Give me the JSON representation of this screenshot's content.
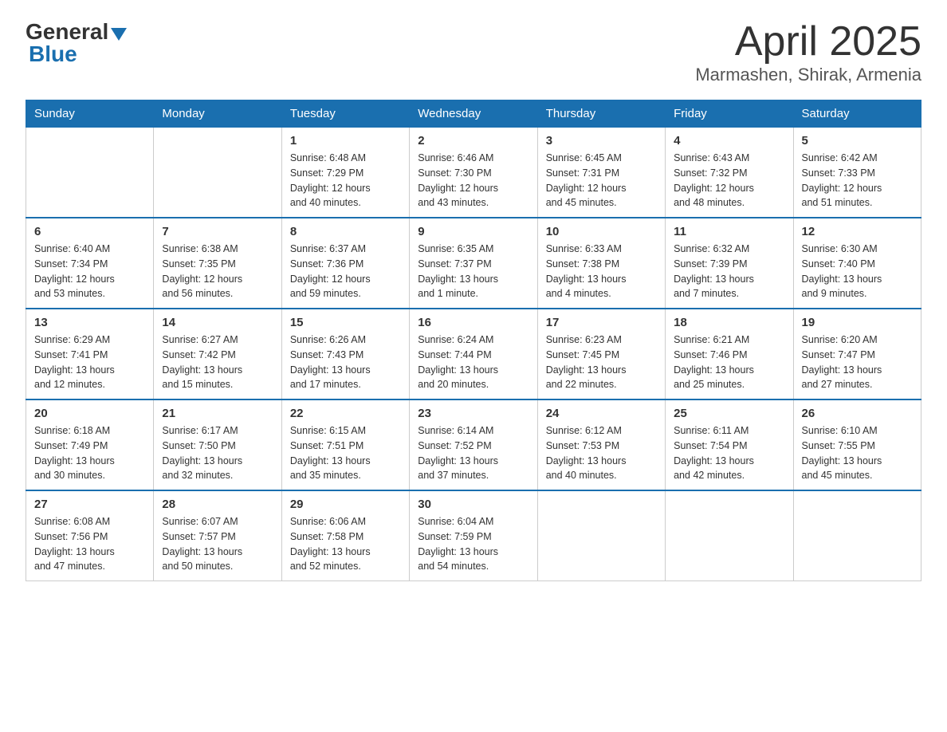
{
  "header": {
    "logo_general": "General",
    "logo_blue": "Blue",
    "title": "April 2025",
    "subtitle": "Marmashen, Shirak, Armenia"
  },
  "days_of_week": [
    "Sunday",
    "Monday",
    "Tuesday",
    "Wednesday",
    "Thursday",
    "Friday",
    "Saturday"
  ],
  "weeks": [
    [
      {
        "day": "",
        "info": ""
      },
      {
        "day": "",
        "info": ""
      },
      {
        "day": "1",
        "info": "Sunrise: 6:48 AM\nSunset: 7:29 PM\nDaylight: 12 hours\nand 40 minutes."
      },
      {
        "day": "2",
        "info": "Sunrise: 6:46 AM\nSunset: 7:30 PM\nDaylight: 12 hours\nand 43 minutes."
      },
      {
        "day": "3",
        "info": "Sunrise: 6:45 AM\nSunset: 7:31 PM\nDaylight: 12 hours\nand 45 minutes."
      },
      {
        "day": "4",
        "info": "Sunrise: 6:43 AM\nSunset: 7:32 PM\nDaylight: 12 hours\nand 48 minutes."
      },
      {
        "day": "5",
        "info": "Sunrise: 6:42 AM\nSunset: 7:33 PM\nDaylight: 12 hours\nand 51 minutes."
      }
    ],
    [
      {
        "day": "6",
        "info": "Sunrise: 6:40 AM\nSunset: 7:34 PM\nDaylight: 12 hours\nand 53 minutes."
      },
      {
        "day": "7",
        "info": "Sunrise: 6:38 AM\nSunset: 7:35 PM\nDaylight: 12 hours\nand 56 minutes."
      },
      {
        "day": "8",
        "info": "Sunrise: 6:37 AM\nSunset: 7:36 PM\nDaylight: 12 hours\nand 59 minutes."
      },
      {
        "day": "9",
        "info": "Sunrise: 6:35 AM\nSunset: 7:37 PM\nDaylight: 13 hours\nand 1 minute."
      },
      {
        "day": "10",
        "info": "Sunrise: 6:33 AM\nSunset: 7:38 PM\nDaylight: 13 hours\nand 4 minutes."
      },
      {
        "day": "11",
        "info": "Sunrise: 6:32 AM\nSunset: 7:39 PM\nDaylight: 13 hours\nand 7 minutes."
      },
      {
        "day": "12",
        "info": "Sunrise: 6:30 AM\nSunset: 7:40 PM\nDaylight: 13 hours\nand 9 minutes."
      }
    ],
    [
      {
        "day": "13",
        "info": "Sunrise: 6:29 AM\nSunset: 7:41 PM\nDaylight: 13 hours\nand 12 minutes."
      },
      {
        "day": "14",
        "info": "Sunrise: 6:27 AM\nSunset: 7:42 PM\nDaylight: 13 hours\nand 15 minutes."
      },
      {
        "day": "15",
        "info": "Sunrise: 6:26 AM\nSunset: 7:43 PM\nDaylight: 13 hours\nand 17 minutes."
      },
      {
        "day": "16",
        "info": "Sunrise: 6:24 AM\nSunset: 7:44 PM\nDaylight: 13 hours\nand 20 minutes."
      },
      {
        "day": "17",
        "info": "Sunrise: 6:23 AM\nSunset: 7:45 PM\nDaylight: 13 hours\nand 22 minutes."
      },
      {
        "day": "18",
        "info": "Sunrise: 6:21 AM\nSunset: 7:46 PM\nDaylight: 13 hours\nand 25 minutes."
      },
      {
        "day": "19",
        "info": "Sunrise: 6:20 AM\nSunset: 7:47 PM\nDaylight: 13 hours\nand 27 minutes."
      }
    ],
    [
      {
        "day": "20",
        "info": "Sunrise: 6:18 AM\nSunset: 7:49 PM\nDaylight: 13 hours\nand 30 minutes."
      },
      {
        "day": "21",
        "info": "Sunrise: 6:17 AM\nSunset: 7:50 PM\nDaylight: 13 hours\nand 32 minutes."
      },
      {
        "day": "22",
        "info": "Sunrise: 6:15 AM\nSunset: 7:51 PM\nDaylight: 13 hours\nand 35 minutes."
      },
      {
        "day": "23",
        "info": "Sunrise: 6:14 AM\nSunset: 7:52 PM\nDaylight: 13 hours\nand 37 minutes."
      },
      {
        "day": "24",
        "info": "Sunrise: 6:12 AM\nSunset: 7:53 PM\nDaylight: 13 hours\nand 40 minutes."
      },
      {
        "day": "25",
        "info": "Sunrise: 6:11 AM\nSunset: 7:54 PM\nDaylight: 13 hours\nand 42 minutes."
      },
      {
        "day": "26",
        "info": "Sunrise: 6:10 AM\nSunset: 7:55 PM\nDaylight: 13 hours\nand 45 minutes."
      }
    ],
    [
      {
        "day": "27",
        "info": "Sunrise: 6:08 AM\nSunset: 7:56 PM\nDaylight: 13 hours\nand 47 minutes."
      },
      {
        "day": "28",
        "info": "Sunrise: 6:07 AM\nSunset: 7:57 PM\nDaylight: 13 hours\nand 50 minutes."
      },
      {
        "day": "29",
        "info": "Sunrise: 6:06 AM\nSunset: 7:58 PM\nDaylight: 13 hours\nand 52 minutes."
      },
      {
        "day": "30",
        "info": "Sunrise: 6:04 AM\nSunset: 7:59 PM\nDaylight: 13 hours\nand 54 minutes."
      },
      {
        "day": "",
        "info": ""
      },
      {
        "day": "",
        "info": ""
      },
      {
        "day": "",
        "info": ""
      }
    ]
  ]
}
